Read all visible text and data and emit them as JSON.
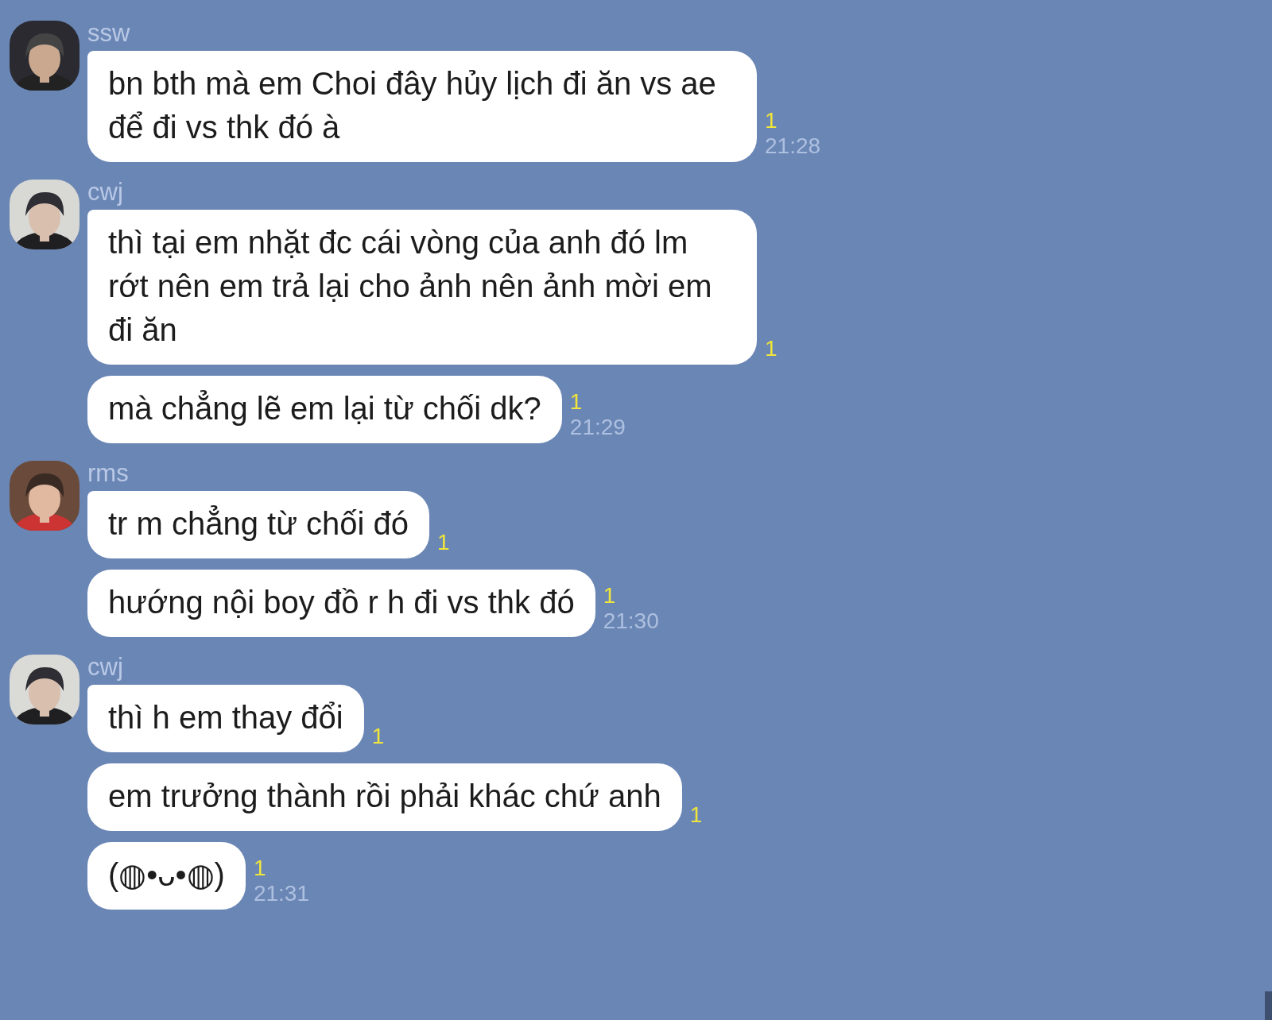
{
  "groups": [
    {
      "sender": "ssw",
      "avatar": {
        "kind": "picture"
      },
      "messages": [
        {
          "text": "bn bth mà em Choi đây hủy lịch đi ăn vs ae để đi vs thk đó à",
          "unread": "1",
          "time": "21:28"
        }
      ]
    },
    {
      "sender": "cwj",
      "avatar": {
        "kind": "picture"
      },
      "messages": [
        {
          "text": "thì tại em nhặt đc cái vòng của anh đó lm rớt nên em trả lại cho ảnh nên ảnh mời em đi ăn",
          "unread": "1"
        },
        {
          "text": "mà chẳng lẽ em lại từ chối dk?",
          "unread": "1",
          "time": "21:29"
        }
      ]
    },
    {
      "sender": "rms",
      "avatar": {
        "kind": "picture"
      },
      "messages": [
        {
          "text": "tr m chẳng từ chối đó",
          "unread": "1"
        },
        {
          "text": "hướng nội boy đồ r h đi vs thk đó",
          "unread": "1",
          "time": "21:30"
        }
      ]
    },
    {
      "sender": "cwj",
      "avatar": {
        "kind": "picture"
      },
      "messages": [
        {
          "text": "thì h em thay đổi",
          "unread": "1"
        },
        {
          "text": "em trưởng thành rồi phải khác chứ anh",
          "unread": "1"
        },
        {
          "text": "(◍•ᴗ•◍)",
          "unread": "1",
          "time": "21:31"
        }
      ]
    }
  ]
}
